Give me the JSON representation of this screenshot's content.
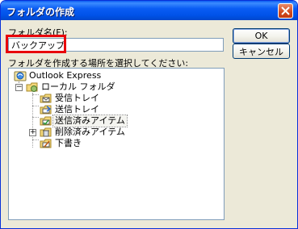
{
  "window": {
    "title": "フォルダの作成"
  },
  "form": {
    "name_label": "フォルダ名(F):",
    "name_value": "バックアップ",
    "location_label": "フォルダを作成する場所を選択してください:"
  },
  "buttons": {
    "ok": "OK",
    "cancel": "キャンセル"
  },
  "tree": {
    "root": "Outlook Express",
    "local": "ローカル フォルダ",
    "inbox": "受信トレイ",
    "outbox": "送信トレイ",
    "sent": "送信済みアイテム",
    "deleted": "削除済みアイテム",
    "drafts": "下書き"
  },
  "colors": {
    "highlight": "#e8000b",
    "titlebar": "#0a5df4"
  }
}
